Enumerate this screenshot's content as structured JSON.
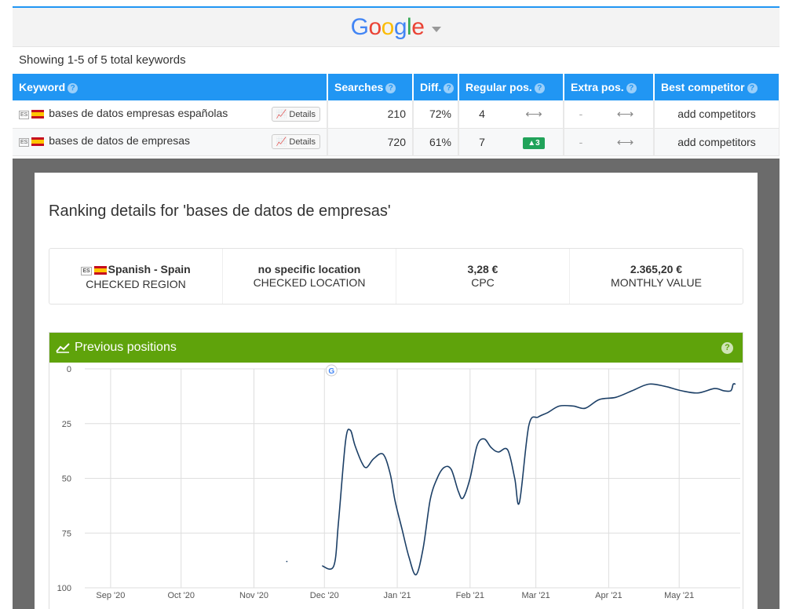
{
  "engine": {
    "name": "Google"
  },
  "summary": "Showing 1-5 of 5 total keywords",
  "table": {
    "headers": [
      "Keyword",
      "Searches",
      "Diff.",
      "Regular pos.",
      "Extra pos.",
      "Best competitor"
    ],
    "rows": [
      {
        "flag_code": "ES",
        "keyword": "bases de datos empresas españolas",
        "details": "Details",
        "searches": "210",
        "diff": "72%",
        "regular_pos": "4",
        "change": "⟷",
        "extra_pos": "-",
        "extra_change": "⟷",
        "competitor": "add competitors"
      },
      {
        "flag_code": "ES",
        "keyword": "bases de datos de empresas",
        "details": "Details",
        "searches": "720",
        "diff": "61%",
        "regular_pos": "7",
        "change": "▲3",
        "extra_pos": "-",
        "extra_change": "⟷",
        "competitor": "add competitors"
      }
    ]
  },
  "modal": {
    "title": "Ranking details for 'bases de datos de empresas'",
    "info": [
      {
        "value": "Spanish - Spain",
        "label": "CHECKED REGION",
        "flag_code": "ES"
      },
      {
        "value": "no specific location",
        "label": "CHECKED LOCATION"
      },
      {
        "value": "3,28 €",
        "label": "CPC"
      },
      {
        "value": "2.365,20 €",
        "label": "MONTHLY VALUE"
      }
    ],
    "panel_title": "Previous positions"
  },
  "colors": {
    "blue": "#2196f3",
    "green": "#5fa30b",
    "line": "#1c3f66",
    "up_badge": "#21a35a"
  },
  "chart_data": {
    "type": "line",
    "title": "",
    "y_inverted": true,
    "ylim": [
      0,
      100
    ],
    "y_ticks": [
      0,
      25,
      50,
      75,
      100
    ],
    "x_ticks": [
      "Sep '20",
      "Oct '20",
      "Nov '20",
      "Dec '20",
      "Jan '21",
      "Feb '21",
      "Mar '21",
      "Apr '21",
      "May '21"
    ],
    "x_range": [
      "2020-08-21",
      "2021-05-27"
    ],
    "grid": true,
    "annotations": [
      {
        "type": "google-update-icon",
        "date": "2020-12-04"
      }
    ],
    "series": [
      {
        "points": [
          [
            "2020-11-30",
            90
          ],
          [
            "2020-12-05",
            90
          ],
          [
            "2020-12-07",
            70
          ],
          [
            "2020-12-10",
            33
          ],
          [
            "2020-12-12",
            28
          ],
          [
            "2020-12-14",
            35
          ],
          [
            "2020-12-17",
            43
          ],
          [
            "2020-12-19",
            45
          ],
          [
            "2020-12-22",
            41
          ],
          [
            "2020-12-26",
            39
          ],
          [
            "2020-12-29",
            48
          ],
          [
            "2020-12-31",
            60
          ],
          [
            "2021-01-03",
            73
          ],
          [
            "2021-01-06",
            86
          ],
          [
            "2021-01-09",
            94
          ],
          [
            "2021-01-12",
            82
          ],
          [
            "2021-01-15",
            60
          ],
          [
            "2021-01-18",
            50
          ],
          [
            "2021-01-21",
            45
          ],
          [
            "2021-01-24",
            46
          ],
          [
            "2021-01-27",
            56
          ],
          [
            "2021-01-29",
            59
          ],
          [
            "2021-02-01",
            50
          ],
          [
            "2021-02-04",
            35
          ],
          [
            "2021-02-07",
            32
          ],
          [
            "2021-02-10",
            36
          ],
          [
            "2021-02-13",
            38
          ],
          [
            "2021-02-17",
            37
          ],
          [
            "2021-02-20",
            50
          ],
          [
            "2021-02-22",
            61
          ],
          [
            "2021-02-26",
            26
          ],
          [
            "2021-03-02",
            22
          ],
          [
            "2021-03-06",
            20
          ],
          [
            "2021-03-11",
            17
          ],
          [
            "2021-03-17",
            17
          ],
          [
            "2021-03-22",
            18
          ],
          [
            "2021-03-28",
            14
          ],
          [
            "2021-04-04",
            13
          ],
          [
            "2021-04-11",
            10
          ],
          [
            "2021-04-18",
            7
          ],
          [
            "2021-04-25",
            8
          ],
          [
            "2021-05-02",
            10
          ],
          [
            "2021-05-09",
            11
          ],
          [
            "2021-05-16",
            9
          ],
          [
            "2021-05-20",
            10
          ],
          [
            "2021-05-23",
            10
          ],
          [
            "2021-05-24",
            7
          ],
          [
            "2021-05-25",
            7
          ]
        ]
      }
    ]
  }
}
